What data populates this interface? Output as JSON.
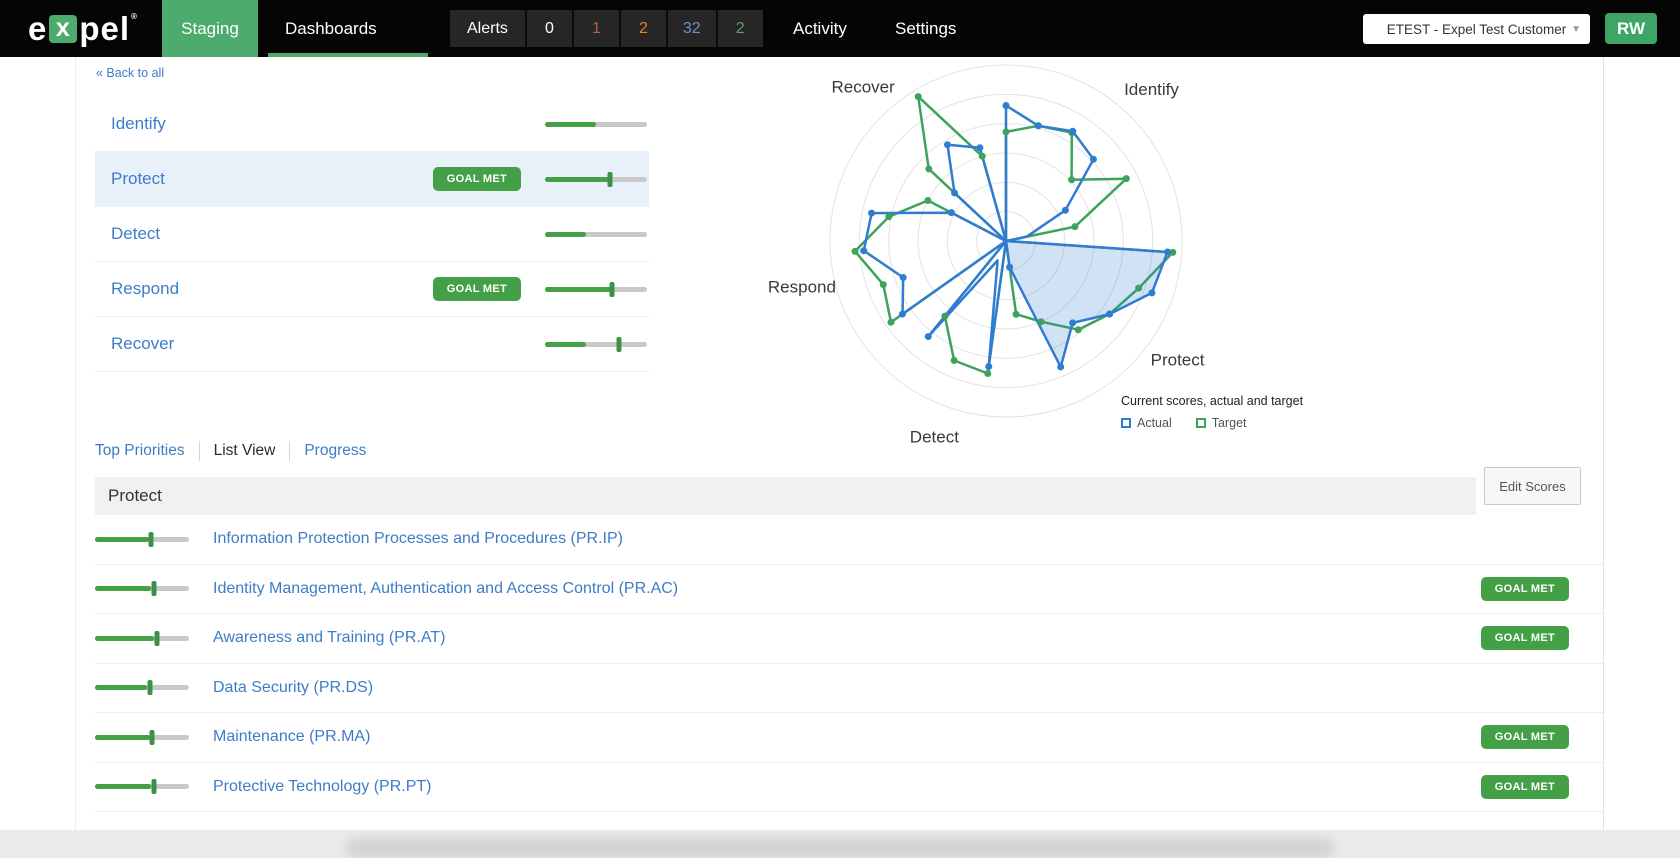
{
  "navbar": {
    "logo": {
      "text_e": "e",
      "text_x": "x",
      "text_pel": "pel",
      "reg": "®"
    },
    "env_tab": "Staging",
    "nav_items": [
      {
        "label": "Dashboards",
        "active": true
      },
      {
        "label": "Activity",
        "active": false
      },
      {
        "label": "Settings",
        "active": false
      }
    ],
    "alerts": {
      "label": "Alerts",
      "counts": [
        {
          "value": "0",
          "color": "#ffffff"
        },
        {
          "value": "1",
          "color": "#b35e42"
        },
        {
          "value": "2",
          "color": "#d98430"
        },
        {
          "value": "32",
          "color": "#6c93c6"
        },
        {
          "value": "2",
          "color": "#58a06c"
        }
      ]
    },
    "customer_select": {
      "value": "ETEST - Expel Test Customer"
    },
    "role_badge": "RW",
    "accent_green": "#4cab6d"
  },
  "back_link": "« Back to all",
  "goal_met_label": "GOAL MET",
  "categories": [
    {
      "label": "Identify",
      "goal_met": false,
      "selected": false,
      "fill_pct": 50,
      "handle_pct": null
    },
    {
      "label": "Protect",
      "goal_met": true,
      "selected": true,
      "fill_pct": 64,
      "handle_pct": 64
    },
    {
      "label": "Detect",
      "goal_met": false,
      "selected": false,
      "fill_pct": 40,
      "handle_pct": null
    },
    {
      "label": "Respond",
      "goal_met": true,
      "selected": false,
      "fill_pct": 66,
      "handle_pct": 66
    },
    {
      "label": "Recover",
      "goal_met": false,
      "selected": false,
      "fill_pct": 40,
      "handle_pct": 73
    }
  ],
  "chart_data": {
    "type": "radar",
    "rings": 6,
    "scale_max": 1,
    "grid": true,
    "legend_title": "Current scores, actual and target",
    "legend": [
      {
        "label": "Actual",
        "color": "#2f7cd0"
      },
      {
        "label": "Target",
        "color": "#3da35c"
      }
    ],
    "axis_labels": [
      "Identify",
      "Protect",
      "Detect",
      "Respond",
      "Recover"
    ],
    "selected_sector": "Protect",
    "fill_color": "rgba(47,125,209,0.22)",
    "sectors": [
      {
        "name": "Identify",
        "label_angle": 44,
        "filled": false,
        "actual": [
          0.77,
          0.68,
          0.73,
          0.68,
          0.38,
          0.12
        ],
        "target": [
          0.62,
          0.68,
          0.72,
          0.51,
          0.77,
          0.4
        ]
      },
      {
        "name": "Protect",
        "label_angle": 125,
        "filled": true,
        "actual": [
          0.92,
          0.88,
          0.72,
          0.6,
          0.78,
          0.15
        ],
        "target": [
          0.95,
          0.8,
          0.72,
          0.65,
          0.5,
          0.42
        ]
      },
      {
        "name": "Detect",
        "label_angle": 200,
        "filled": false,
        "actual": [
          0.72,
          0.12,
          0.7
        ],
        "target": [
          0.76,
          0.74,
          0.55
        ]
      },
      {
        "name": "Respond",
        "label_angle": 257,
        "filled": false,
        "actual": [
          0.72,
          0.62,
          0.81,
          0.78,
          0.35
        ],
        "target": [
          0.8,
          0.74,
          0.86,
          0.68,
          0.5
        ]
      },
      {
        "name": "Recover",
        "label_angle": 317,
        "filled": false,
        "actual": [
          0.4,
          0.64,
          0.55
        ],
        "target": [
          0.6,
          0.96,
          0.5
        ]
      }
    ]
  },
  "tabs": [
    {
      "label": "Top Priorities",
      "active": false
    },
    {
      "label": "List View",
      "active": true
    },
    {
      "label": "Progress",
      "active": false
    }
  ],
  "section": {
    "title": "Protect",
    "edit_button": "Edit Scores"
  },
  "subcategories": [
    {
      "label": "Information Protection Processes and Procedures (PR.IP)",
      "goal_met": false,
      "fill_pct": 57,
      "handle_pct": 60
    },
    {
      "label": "Identity Management, Authentication and Access Control (PR.AC)",
      "goal_met": true,
      "fill_pct": 60,
      "handle_pct": 63
    },
    {
      "label": "Awareness and Training (PR.AT)",
      "goal_met": true,
      "fill_pct": 63,
      "handle_pct": 66
    },
    {
      "label": "Data Security (PR.DS)",
      "goal_met": false,
      "fill_pct": 55,
      "handle_pct": 58
    },
    {
      "label": "Maintenance (PR.MA)",
      "goal_met": true,
      "fill_pct": 58,
      "handle_pct": 61
    },
    {
      "label": "Protective Technology (PR.PT)",
      "goal_met": true,
      "fill_pct": 60,
      "handle_pct": 63
    }
  ]
}
